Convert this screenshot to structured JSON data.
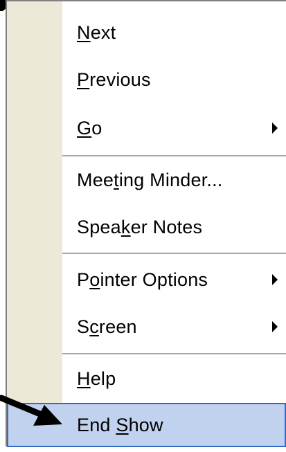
{
  "menu": {
    "items": [
      {
        "label": "Next",
        "mnemonic": "N",
        "rest": "ext",
        "has_submenu": false
      },
      {
        "label": "Previous",
        "mnemonic": "P",
        "rest": "revious",
        "has_submenu": false
      },
      {
        "label": "Go",
        "mnemonic": "G",
        "rest": "o",
        "has_submenu": true
      },
      {
        "label": "Meeting Minder...",
        "pre": "Mee",
        "mnemonic": "t",
        "rest": "ing Minder...",
        "has_submenu": false
      },
      {
        "label": "Speaker Notes",
        "pre": "Spea",
        "mnemonic": "k",
        "rest": "er Notes",
        "has_submenu": false
      },
      {
        "label": "Pointer Options",
        "pre": "P",
        "mnemonic": "o",
        "rest": "inter Options",
        "has_submenu": true
      },
      {
        "label": "Screen",
        "pre": "S",
        "mnemonic": "c",
        "rest": "reen",
        "has_submenu": true
      },
      {
        "label": "Help",
        "mnemonic": "H",
        "rest": "elp",
        "has_submenu": false
      },
      {
        "label": "End Show",
        "pre": "End ",
        "mnemonic": "S",
        "rest": "how",
        "has_submenu": false,
        "highlighted": true
      }
    ]
  },
  "colors": {
    "gutter": "#ece9d8",
    "highlight_fill": "#c1d2ee",
    "highlight_border": "#316ac5",
    "separator": "#a7a6aa",
    "arrow": "#000000"
  },
  "icons": {
    "submenu": "chevron-right-icon",
    "pointer_arrow": "arrow-icon"
  }
}
